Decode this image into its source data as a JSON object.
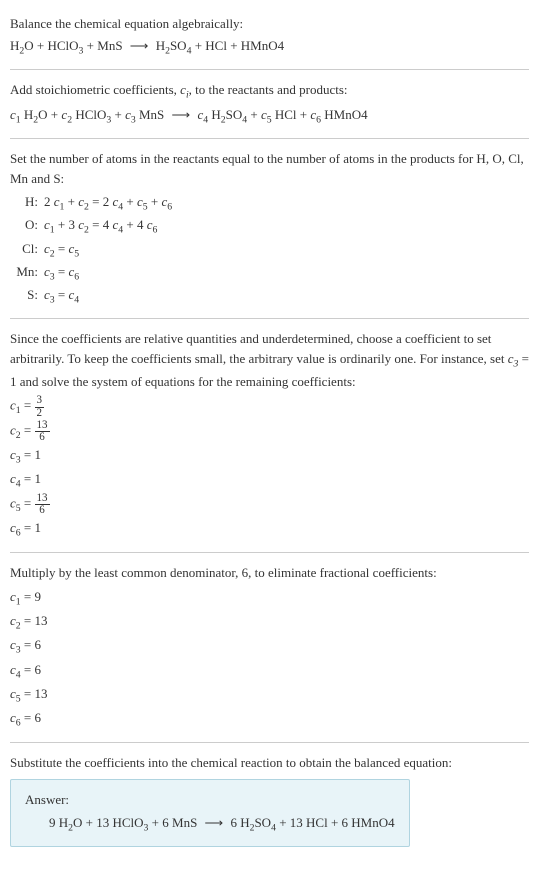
{
  "section1": {
    "title": "Balance the chemical equation algebraically:",
    "equation": "H₂O + HClO₃ + MnS ⟶ H₂SO₄ + HCl + HMnO4"
  },
  "section2": {
    "intro_part1": "Add stoichiometric coefficients, ",
    "intro_ci": "cᵢ",
    "intro_part2": ", to the reactants and products:",
    "equation": "c₁ H₂O + c₂ HClO₃ + c₃ MnS ⟶ c₄ H₂SO₄ + c₅ HCl + c₆ HMnO4"
  },
  "section3": {
    "intro": "Set the number of atoms in the reactants equal to the number of atoms in the products for H, O, Cl, Mn and S:",
    "rows": [
      {
        "label": "H:",
        "eq": "2 c₁ + c₂ = 2 c₄ + c₅ + c₆"
      },
      {
        "label": "O:",
        "eq": "c₁ + 3 c₂ = 4 c₄ + 4 c₆"
      },
      {
        "label": "Cl:",
        "eq": "c₂ = c₅"
      },
      {
        "label": "Mn:",
        "eq": "c₃ = c₆"
      },
      {
        "label": "S:",
        "eq": "c₃ = c₄"
      }
    ]
  },
  "section4": {
    "intro_p1": "Since the coefficients are relative quantities and underdetermined, choose a coefficient to set arbitrarily. To keep the coefficients small, the arbitrary value is ordinarily one. For instance, set ",
    "intro_c3": "c₃ = 1",
    "intro_p2": " and solve the system of equations for the remaining coefficients:",
    "coeffs": [
      {
        "var": "c₁",
        "eq": "=",
        "num": "3",
        "den": "2",
        "isfrac": true
      },
      {
        "var": "c₂",
        "eq": "=",
        "num": "13",
        "den": "6",
        "isfrac": true
      },
      {
        "var": "c₃",
        "eq": "=",
        "val": "1",
        "isfrac": false
      },
      {
        "var": "c₄",
        "eq": "=",
        "val": "1",
        "isfrac": false
      },
      {
        "var": "c₅",
        "eq": "=",
        "num": "13",
        "den": "6",
        "isfrac": true
      },
      {
        "var": "c₆",
        "eq": "=",
        "val": "1",
        "isfrac": false
      }
    ]
  },
  "section5": {
    "intro": "Multiply by the least common denominator, 6, to eliminate fractional coefficients:",
    "coeffs": [
      {
        "var": "c₁",
        "val": "= 9"
      },
      {
        "var": "c₂",
        "val": "= 13"
      },
      {
        "var": "c₃",
        "val": "= 6"
      },
      {
        "var": "c₄",
        "val": "= 6"
      },
      {
        "var": "c₅",
        "val": "= 13"
      },
      {
        "var": "c₆",
        "val": "= 6"
      }
    ]
  },
  "section6": {
    "intro": "Substitute the coefficients into the chemical reaction to obtain the balanced equation:",
    "answer_label": "Answer:",
    "answer_eq": "9 H₂O + 13 HClO₃ + 6 MnS ⟶ 6 H₂SO₄ + 13 HCl + 6 HMnO4"
  }
}
